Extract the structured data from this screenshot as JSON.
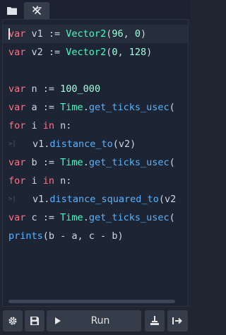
{
  "tabs": [
    {
      "name": "folder-icon",
      "active": false
    },
    {
      "name": "ast-icon",
      "active": true
    }
  ],
  "code": {
    "lines": [
      {
        "parts": [
          [
            "kw",
            "var"
          ],
          [
            "p",
            " v1 := "
          ],
          [
            "cls",
            "Vector2"
          ],
          [
            "p",
            "("
          ],
          [
            "num",
            "96"
          ],
          [
            "p",
            ", "
          ],
          [
            "num",
            "0"
          ],
          [
            "p",
            ")"
          ]
        ],
        "indent": false,
        "current": true
      },
      {
        "parts": [
          [
            "kw",
            "var"
          ],
          [
            "p",
            " v2 := "
          ],
          [
            "cls",
            "Vector2"
          ],
          [
            "p",
            "("
          ],
          [
            "num",
            "0"
          ],
          [
            "p",
            ", "
          ],
          [
            "num",
            "128"
          ],
          [
            "p",
            ")"
          ]
        ],
        "indent": false
      },
      {
        "parts": [],
        "indent": false
      },
      {
        "parts": [
          [
            "kw",
            "var"
          ],
          [
            "p",
            " n := "
          ],
          [
            "num",
            "100_000"
          ]
        ],
        "indent": false
      },
      {
        "parts": [
          [
            "kw",
            "var"
          ],
          [
            "p",
            " a := "
          ],
          [
            "cls",
            "Time"
          ],
          [
            "p",
            "."
          ],
          [
            "fn",
            "get_ticks_usec"
          ],
          [
            "p",
            "("
          ]
        ],
        "indent": false
      },
      {
        "parts": [
          [
            "kw",
            "for"
          ],
          [
            "p",
            " i "
          ],
          [
            "kw",
            "in"
          ],
          [
            "p",
            " n:"
          ]
        ],
        "indent": false
      },
      {
        "parts": [
          [
            "p",
            "v1."
          ],
          [
            "fn",
            "distance_to"
          ],
          [
            "p",
            "(v2)"
          ]
        ],
        "indent": true
      },
      {
        "parts": [
          [
            "kw",
            "var"
          ],
          [
            "p",
            " b := "
          ],
          [
            "cls",
            "Time"
          ],
          [
            "p",
            "."
          ],
          [
            "fn",
            "get_ticks_usec"
          ],
          [
            "p",
            "("
          ]
        ],
        "indent": false
      },
      {
        "parts": [
          [
            "kw",
            "for"
          ],
          [
            "p",
            " i "
          ],
          [
            "kw",
            "in"
          ],
          [
            "p",
            " n:"
          ]
        ],
        "indent": false
      },
      {
        "parts": [
          [
            "p",
            "v1."
          ],
          [
            "fn",
            "distance_squared_to"
          ],
          [
            "p",
            "(v2"
          ]
        ],
        "indent": true
      },
      {
        "parts": [
          [
            "kw",
            "var"
          ],
          [
            "p",
            " c := "
          ],
          [
            "cls",
            "Time"
          ],
          [
            "p",
            "."
          ],
          [
            "fn",
            "get_ticks_usec"
          ],
          [
            "p",
            "("
          ]
        ],
        "indent": false
      },
      {
        "parts": [
          [
            "fn",
            "prints"
          ],
          [
            "p",
            "(b - a, c - b)"
          ]
        ],
        "indent": false
      }
    ]
  },
  "toolbar": {
    "run_label": "Run"
  },
  "colors": {
    "keyword": "#ff7085",
    "class": "#42ffc2",
    "function": "#57b3ff",
    "number": "#a1ffe0"
  }
}
